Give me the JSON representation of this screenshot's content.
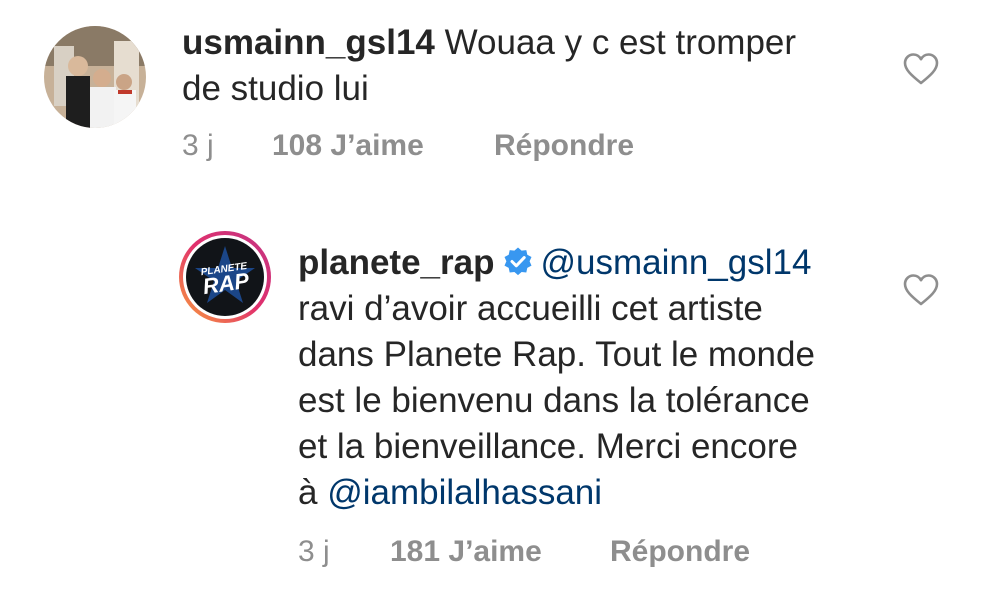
{
  "comments": [
    {
      "username": "usmainn_gsl14",
      "text": " Wouaa  y c est tromper",
      "text_line2": "de studio lui",
      "time": "3 j",
      "likes": "108 J’aime",
      "reply": "Répondre",
      "avatar_icon": "user-photo-avatar",
      "like_icon": "heart-outline-icon"
    },
    {
      "username": "planete_rap",
      "verified_icon": "verified-badge-icon",
      "mention": "@usmainn_gsl14",
      "lines": [
        "ravi d’avoir accueilli cet artiste",
        "dans Planete Rap. Tout le monde",
        "est le bienvenu dans la tolérance",
        "et la bienveillance. Merci encore",
        "à "
      ],
      "mention2": "@iambilalhassani",
      "time": "3 j",
      "likes": "181 J’aime",
      "reply": "Répondre",
      "avatar_icon": "planete-rap-logo-avatar",
      "avatar_logo_text": [
        "PLANETE",
        "RAP"
      ],
      "like_icon": "heart-outline-icon"
    }
  ],
  "colors": {
    "text": "#262626",
    "meta": "#8e8e8e",
    "mention": "#00376b",
    "verified": "#3897f0"
  }
}
